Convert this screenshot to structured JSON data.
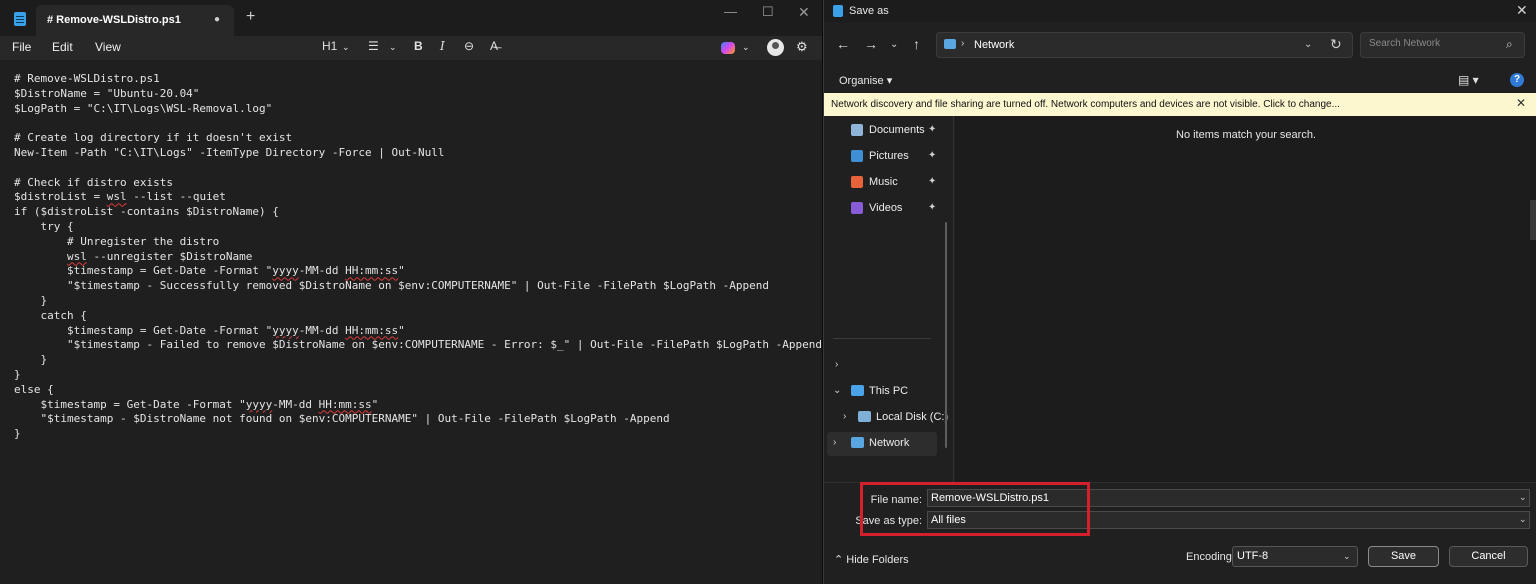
{
  "notepad": {
    "tab_title": "# Remove-WSLDistro.ps1",
    "tab_modified_dot": "●",
    "new_tab": "+",
    "window_controls": {
      "minimize": "—",
      "maximize": "☐",
      "close": "✕"
    },
    "menu": {
      "file": "File",
      "edit": "Edit",
      "view": "View"
    },
    "toolbar": {
      "heading": "H1",
      "chevron": "⌄",
      "list": "☰",
      "bold": "B",
      "italic": "I",
      "link": "⊖",
      "clear_format": "A̶",
      "settings": "⚙"
    },
    "code_lines": [
      "# Remove-WSLDistro.ps1",
      "$DistroName = \"Ubuntu-20.04\"",
      "$LogPath = \"C:\\IT\\Logs\\WSL-Removal.log\"",
      "",
      "# Create log directory if it doesn't exist",
      "New-Item -Path \"C:\\IT\\Logs\" -ItemType Directory -Force | Out-Null",
      "",
      "# Check if distro exists",
      "$distroList = wsl --list --quiet",
      "if ($distroList -contains $DistroName) {",
      "    try {",
      "        # Unregister the distro",
      "        wsl --unregister $DistroName",
      "        $timestamp = Get-Date -Format \"yyyy-MM-dd HH:mm:ss\"",
      "        \"$timestamp - Successfully removed $DistroName on $env:COMPUTERNAME\" | Out-File -FilePath $LogPath -Append",
      "    }",
      "    catch {",
      "        $timestamp = Get-Date -Format \"yyyy-MM-dd HH:mm:ss\"",
      "        \"$timestamp - Failed to remove $DistroName on $env:COMPUTERNAME - Error: $_\" | Out-File -FilePath $LogPath -Append",
      "    }",
      "}",
      "else {",
      "    $timestamp = Get-Date -Format \"yyyy-MM-dd HH:mm:ss\"",
      "    \"$timestamp - $DistroName not found on $env:COMPUTERNAME\" | Out-File -FilePath $LogPath -Append",
      "}"
    ],
    "spellcheck_words": [
      "wsl",
      "yyyy",
      "HH:mm:ss",
      "FilePath"
    ]
  },
  "dialog": {
    "title": "Save as",
    "close": "✕",
    "nav": {
      "back": "←",
      "forward": "→",
      "recent": "⌄",
      "up": "↑"
    },
    "address": {
      "separator": "›",
      "location": "Network",
      "chevron": "⌄",
      "refresh": "↻"
    },
    "search": {
      "placeholder": "Search Network",
      "icon": "⌕"
    },
    "organise": "Organise ▾",
    "view_menu": "▤ ▾",
    "help": "?",
    "info_bar": {
      "text": "Network discovery and file sharing are turned off. Network computers and devices are not visible. Click to change...",
      "close": "✕"
    },
    "quick_access": [
      {
        "label": "Documents",
        "icon": "documents-icon",
        "color": "#8fb3d9"
      },
      {
        "label": "Pictures",
        "icon": "pictures-icon",
        "color": "#3f8fd6"
      },
      {
        "label": "Music",
        "icon": "music-icon",
        "color": "#e8623a"
      },
      {
        "label": "Videos",
        "icon": "videos-icon",
        "color": "#8a5bd6"
      }
    ],
    "pin": "✦",
    "tree": {
      "collapsed_chev": "›",
      "expanded_chev": "⌄",
      "this_pc": "This PC",
      "local_disk": "Local Disk (C:)",
      "network": "Network"
    },
    "empty_message": "No items match your search.",
    "file_name_label": "File name:",
    "file_name_value": "Remove-WSLDistro.ps1",
    "save_as_type_label": "Save as type:",
    "save_as_type_value": "All files",
    "hide_folders": "⌃  Hide Folders",
    "encoding_label": "Encoding:",
    "encoding_value": "UTF-8",
    "save_button": "Save",
    "cancel_button": "Cancel",
    "dropdown_chev": "⌄",
    "highlight_color": "#d3202a"
  }
}
